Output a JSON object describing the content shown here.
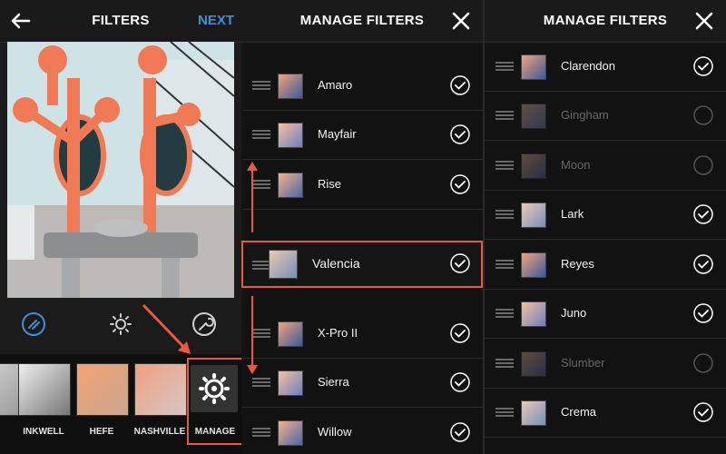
{
  "panel1": {
    "title": "FILTERS",
    "next_label": "NEXT",
    "thumbs": [
      {
        "label": "INKWELL"
      },
      {
        "label": "HEFE"
      },
      {
        "label": "NASHVILLE"
      },
      {
        "label": "MANAGE"
      }
    ]
  },
  "panel2": {
    "title": "MANAGE FILTERS",
    "rows": [
      {
        "name": "Amaro",
        "checked": true
      },
      {
        "name": "Mayfair",
        "checked": true
      },
      {
        "name": "Rise",
        "checked": true
      },
      {
        "name": "Valencia",
        "checked": true
      },
      {
        "name": "X-Pro II",
        "checked": true
      },
      {
        "name": "Sierra",
        "checked": true
      },
      {
        "name": "Willow",
        "checked": true
      }
    ]
  },
  "panel3": {
    "title": "MANAGE FILTERS",
    "rows": [
      {
        "name": "Clarendon",
        "checked": true
      },
      {
        "name": "Gingham",
        "checked": false
      },
      {
        "name": "Moon",
        "checked": false
      },
      {
        "name": "Lark",
        "checked": true
      },
      {
        "name": "Reyes",
        "checked": true
      },
      {
        "name": "Juno",
        "checked": true
      },
      {
        "name": "Slumber",
        "checked": false
      },
      {
        "name": "Crema",
        "checked": true
      }
    ]
  },
  "colors": {
    "accent_next": "#3f8fd8",
    "highlight": "#e85a3c"
  }
}
